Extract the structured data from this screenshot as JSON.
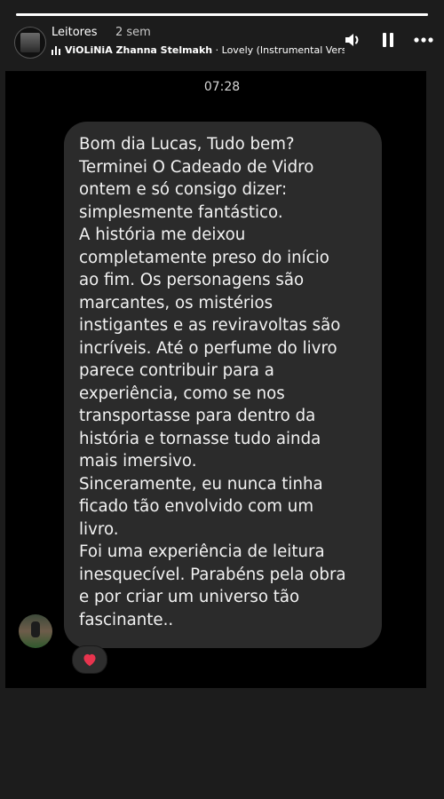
{
  "story": {
    "progress_fraction": 1.0
  },
  "header": {
    "account_name": "Leitores",
    "time_ago": "2 sem",
    "music": {
      "artist": "ViOLiNiA Zhanna Stelmakh",
      "separator": " · ",
      "track": "Lovely (Instrumental Versi"
    }
  },
  "controls": {
    "volume_icon": "speaker-volume-icon",
    "pause_icon": "pause-icon",
    "more_icon": "more-options-icon"
  },
  "screenshot": {
    "status_time": "07:28",
    "message_text": "Bom dia Lucas, Tudo bem?\nTerminei O Cadeado de Vidro\nontem e só consigo dizer:\nsimplesmente fantástico.\nA história me deixou\ncompletamente preso do início\nao fim. Os personagens são\nmarcantes, os mistérios\ninstigantes e as reviravoltas são\nincríveis. Até o perfume do livro\nparece contribuir para a\nexperiência, como se nos\ntransportasse para dentro da\nhistória e tornasse tudo ainda\nmais imersivo.\nSinceramente, eu nunca tinha\nficado tão envolvido com um\nlivro.\nFoi uma experiência de leitura\ninesquecível. Parabéns pela obra\ne por criar um universo tão\nfascinante..",
    "reaction_icon": "heart-icon",
    "reaction_color": "#e8344e"
  },
  "colors": {
    "background": "#1c1c1c",
    "bubble": "#2b2b2b",
    "story_black": "#000000"
  }
}
